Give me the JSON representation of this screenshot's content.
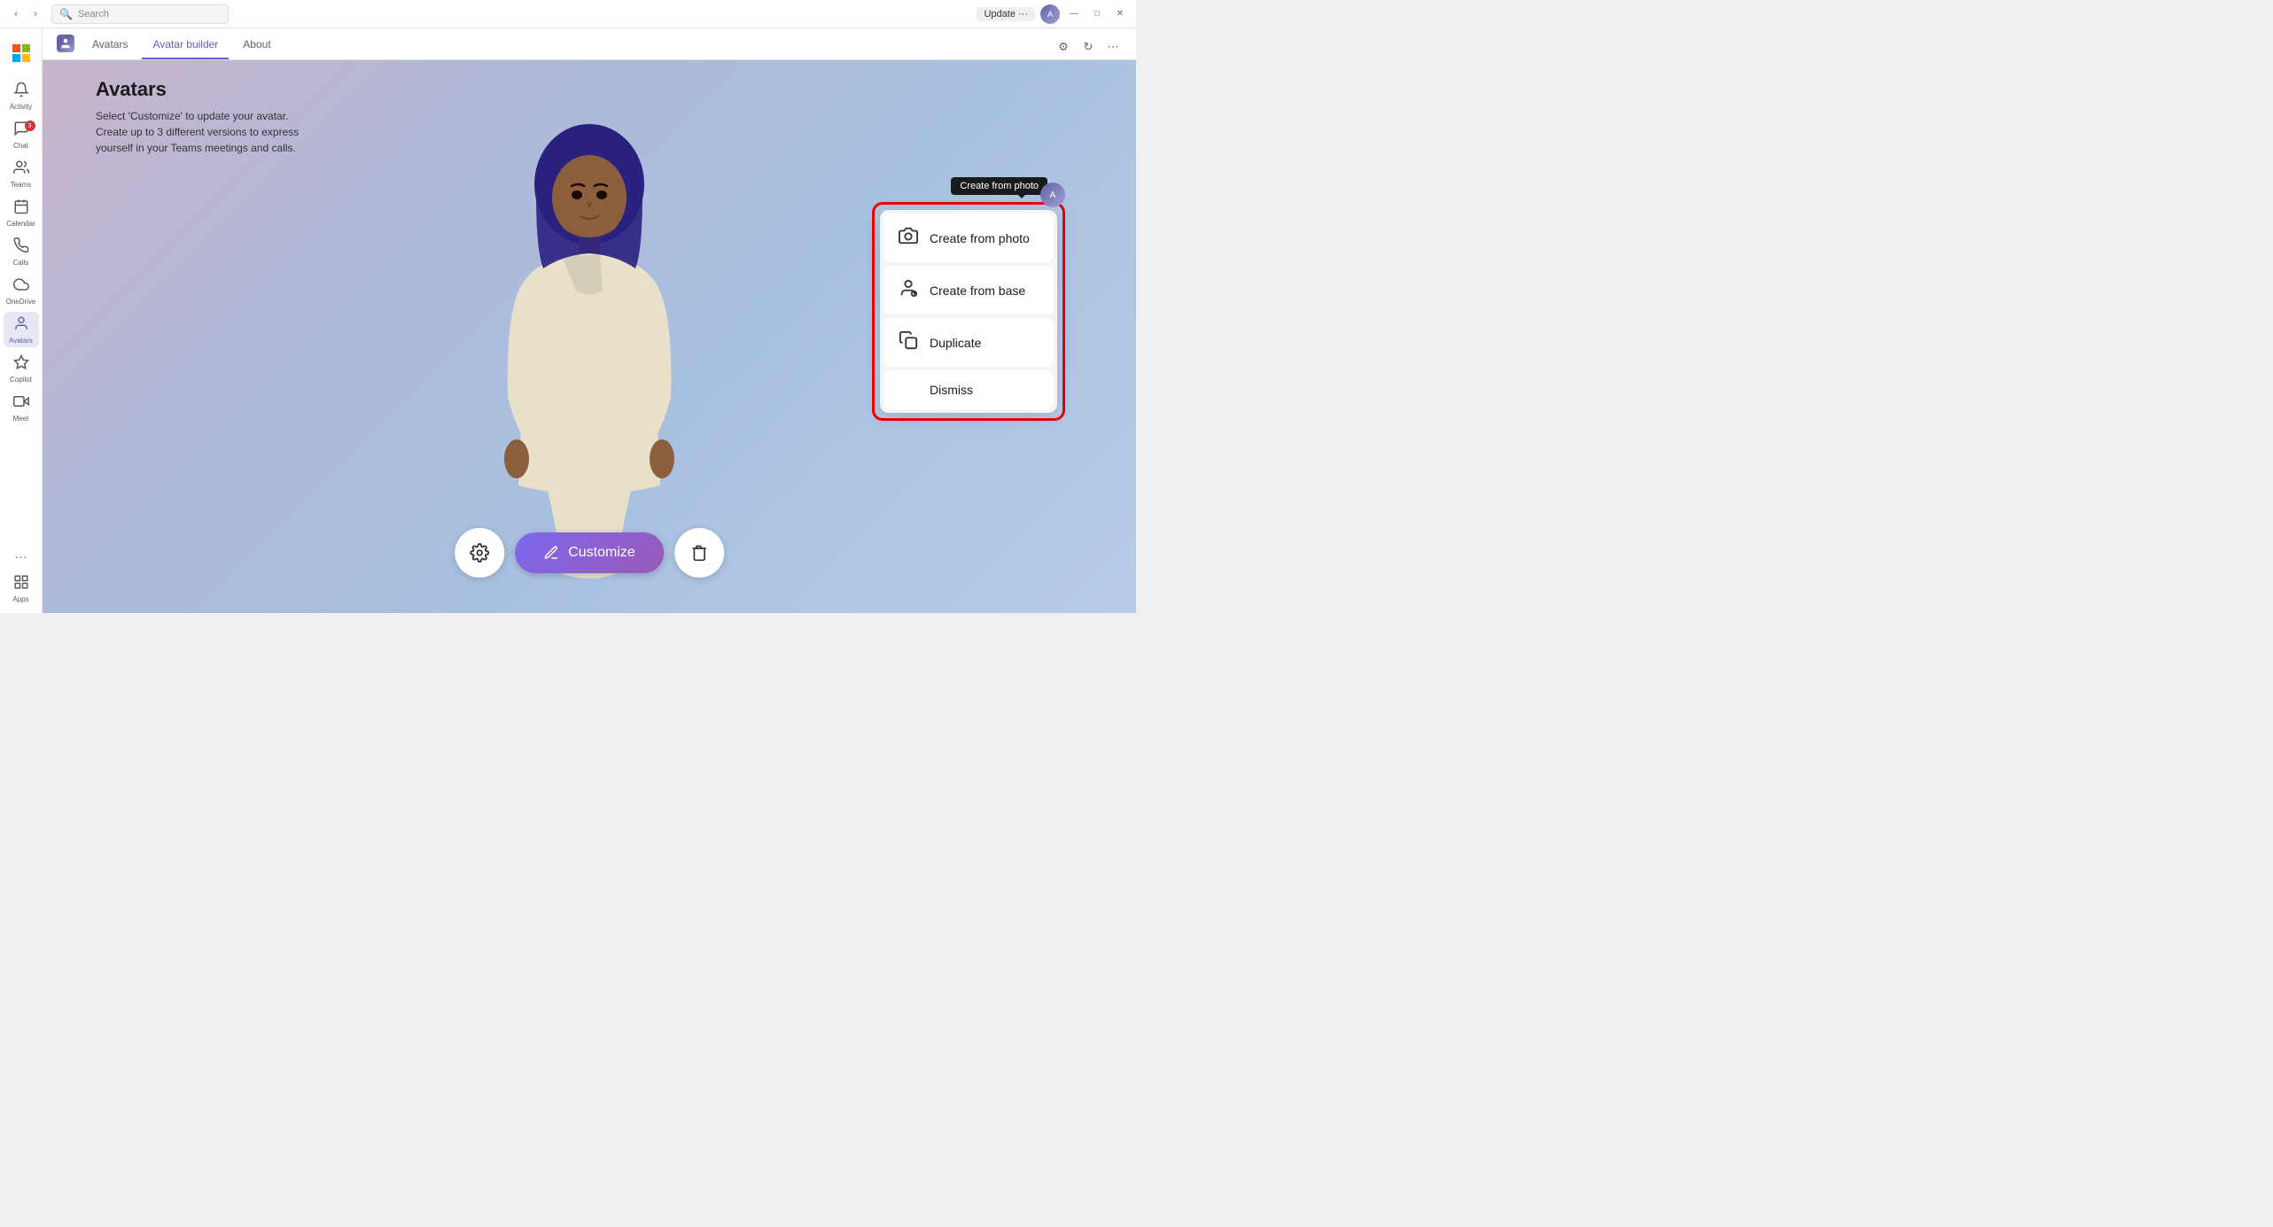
{
  "titlebar": {
    "update_label": "Update ···",
    "search_placeholder": "Search"
  },
  "sidebar": {
    "logo_icon": "🪟",
    "items": [
      {
        "id": "activity",
        "label": "Activity",
        "icon": "🔔",
        "badge": null,
        "active": false
      },
      {
        "id": "chat",
        "label": "Chat",
        "icon": "💬",
        "badge": "3",
        "active": false
      },
      {
        "id": "teams",
        "label": "Teams",
        "icon": "👥",
        "badge": null,
        "active": false
      },
      {
        "id": "calendar",
        "label": "Calendar",
        "icon": "📅",
        "badge": null,
        "active": false
      },
      {
        "id": "calls",
        "label": "Calls",
        "icon": "📞",
        "badge": null,
        "active": false
      },
      {
        "id": "onedrive",
        "label": "OneDrive",
        "icon": "☁️",
        "badge": null,
        "active": false
      },
      {
        "id": "avatars",
        "label": "Avatars",
        "icon": "🧑",
        "badge": null,
        "active": true
      },
      {
        "id": "copilot",
        "label": "Copilot",
        "icon": "✨",
        "badge": null,
        "active": false
      },
      {
        "id": "meet",
        "label": "Meet",
        "icon": "🎥",
        "badge": null,
        "active": false
      }
    ],
    "bottom_items": [
      {
        "id": "apps",
        "label": "Apps",
        "icon": "⊞"
      }
    ]
  },
  "tabs": {
    "app_icon": "🧑",
    "app_name": "Avatars",
    "items": [
      {
        "id": "avatars",
        "label": "Avatars",
        "active": false
      },
      {
        "id": "avatar-builder",
        "label": "Avatar builder",
        "active": true
      },
      {
        "id": "about",
        "label": "About",
        "active": false
      }
    ]
  },
  "page": {
    "title": "Avatars",
    "description": "Select 'Customize' to update your avatar.\nCreate up to 3 different versions to express\nyourself in your Teams meetings and calls."
  },
  "popup": {
    "tooltip": "Create from photo",
    "items": [
      {
        "id": "create-from-photo",
        "label": "Create from photo",
        "icon": "📷"
      },
      {
        "id": "create-from-base",
        "label": "Create from base",
        "icon": "👤"
      },
      {
        "id": "duplicate",
        "label": "Duplicate",
        "icon": "📋"
      },
      {
        "id": "dismiss",
        "label": "Dismiss",
        "icon": ""
      }
    ]
  },
  "toolbar": {
    "settings_icon": "⚙️",
    "customize_icon": "✏️",
    "customize_label": "Customize",
    "delete_icon": "🗑️"
  }
}
